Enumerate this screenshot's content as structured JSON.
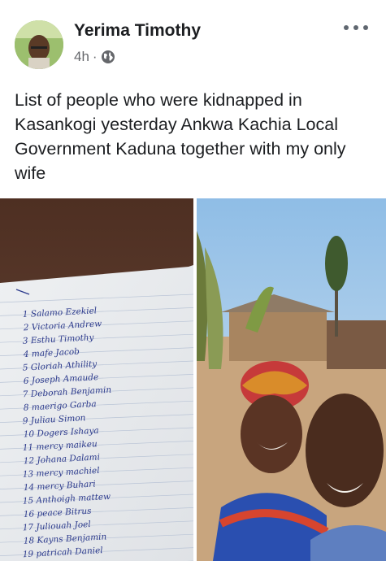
{
  "post": {
    "author": "Yerima Timothy",
    "time": "4h",
    "separator": "·",
    "privacy_icon": "globe-icon",
    "more_icon": "more-options-icon",
    "text": "List of people who were kidnapped in Kasankogi yesterday Ankwa Kachia Local Government Kaduna  together with my only wife"
  },
  "handwritten_list": [
    "1 Salamo Ezekiel",
    "2 Victoria Andrew",
    "3 Esthu Timothy",
    "4 mafe Jacob",
    "5 Gloriah Athility",
    "6 Joseph Amaude",
    "7 Deborah Benjamin",
    "8 maerigo Garba",
    "9 Juliau Simon",
    "10 Dogers Ishaya",
    "11 mercy maikeu",
    "12 Johana Dalami",
    "13 mercy machiel",
    "14 mercy Buhari",
    "15 Anthoigh mattew",
    "16 peace Bitrus",
    "17 Juliouah Joel",
    "18 Kayns Benjamin",
    "19 patricah Daniel"
  ],
  "colors": {
    "name": "#1c1e21",
    "meta": "#65676b",
    "ink": "#2c3a8c"
  }
}
